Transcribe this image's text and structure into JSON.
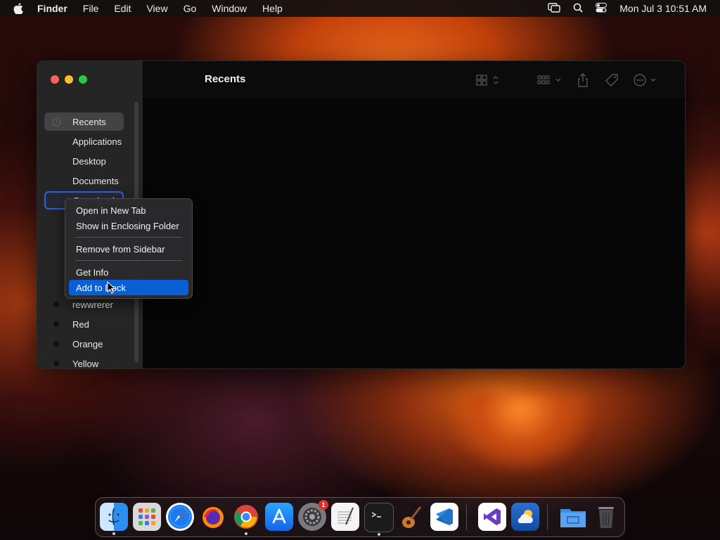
{
  "menubar": {
    "app_name": "Finder",
    "items": [
      "File",
      "Edit",
      "View",
      "Go",
      "Window",
      "Help"
    ],
    "clock": "Mon Jul 3  10:51 AM"
  },
  "window": {
    "title": "Recents",
    "sidebar": {
      "favorites_header": "",
      "items": [
        {
          "label": "Recents",
          "icon": "clock-icon"
        },
        {
          "label": "Applications",
          "icon": "applications-icon"
        },
        {
          "label": "Desktop",
          "icon": "desktop-icon"
        },
        {
          "label": "Documents",
          "icon": "documents-icon"
        },
        {
          "label": "Downloads",
          "icon": "downloads-icon"
        }
      ],
      "tags": [
        {
          "label": "rewwrerer",
          "color": "#111111"
        },
        {
          "label": "Red",
          "color": "#111111"
        },
        {
          "label": "Orange",
          "color": "#111111"
        },
        {
          "label": "Yellow",
          "color": "#111111"
        }
      ]
    }
  },
  "context_menu": {
    "items": [
      {
        "label": "Open in New Tab"
      },
      {
        "label": "Show in Enclosing Folder"
      },
      {
        "label": "Remove from Sidebar"
      },
      {
        "label": "Get Info"
      },
      {
        "label": "Add to Dock",
        "highlighted": true
      }
    ]
  },
  "dock": {
    "apps": [
      "Finder",
      "Launchpad",
      "Safari",
      "Firefox",
      "Chrome",
      "App Store",
      "System Settings",
      "TextEdit",
      "Terminal",
      "Instruments",
      "Visual Studio Code",
      "Visual Studio",
      "Weather",
      "Downloads Folder",
      "Trash"
    ],
    "settings_badge": "1"
  },
  "colors": {
    "accent": "#0a5fd7",
    "selection_outline": "#2f5fe0",
    "close": "#ff5f57",
    "minimize": "#febc2e",
    "zoom": "#28c840"
  }
}
